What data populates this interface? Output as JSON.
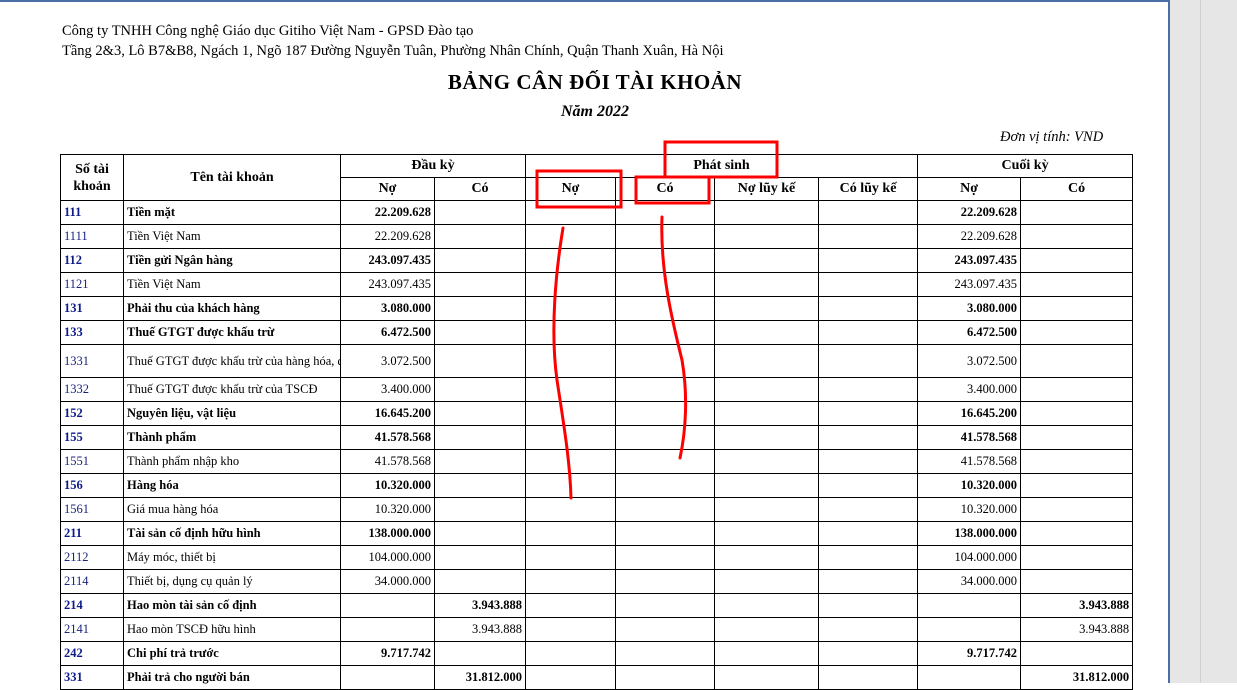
{
  "header": {
    "company": "Công ty TNHH Công nghệ Giáo dục Gitiho Việt Nam - GPSD Đào tạo",
    "address": "Tầng 2&3, Lô B7&B8, Ngách 1, Ngõ 187 Đường Nguyễn Tuân, Phường Nhân Chính, Quận Thanh Xuân, Hà Nội",
    "title": "BẢNG CÂN ĐỐI TÀI KHOẢN",
    "year": "Năm 2022",
    "unit": "Đơn vị tính: VND"
  },
  "table": {
    "col_account_no": "Số tài khoản",
    "col_account_name": "Tên tài khoản",
    "group_opening": "Đầu kỳ",
    "group_movement": "Phát sinh",
    "group_closing": "Cuối kỳ",
    "sub_debit": "Nợ",
    "sub_credit": "Có",
    "sub_cum_debit": "Nợ lũy kế",
    "sub_cum_credit": "Có lũy kế",
    "rows": [
      {
        "code": "111",
        "name": "Tiền mặt",
        "od": "22.209.628",
        "oc": "",
        "cd": "22.209.628",
        "cc": ""
      },
      {
        "code": "1111",
        "name": "Tiền Việt Nam",
        "od": "22.209.628",
        "oc": "",
        "cd": "22.209.628",
        "cc": ""
      },
      {
        "code": "112",
        "name": "Tiền gửi Ngân hàng",
        "od": "243.097.435",
        "oc": "",
        "cd": "243.097.435",
        "cc": ""
      },
      {
        "code": "1121",
        "name": "Tiền Việt Nam",
        "od": "243.097.435",
        "oc": "",
        "cd": "243.097.435",
        "cc": ""
      },
      {
        "code": "131",
        "name": "Phải thu của khách hàng",
        "od": "3.080.000",
        "oc": "",
        "cd": "3.080.000",
        "cc": ""
      },
      {
        "code": "133",
        "name": "Thuế GTGT được khấu trừ",
        "od": "6.472.500",
        "oc": "",
        "cd": "6.472.500",
        "cc": ""
      },
      {
        "code": "1331",
        "name": "Thuế GTGT được khấu trừ của hàng hóa, dịch vụ",
        "od": "3.072.500",
        "oc": "",
        "cd": "3.072.500",
        "cc": ""
      },
      {
        "code": "1332",
        "name": "Thuế GTGT được khấu trừ của TSCĐ",
        "od": "3.400.000",
        "oc": "",
        "cd": "3.400.000",
        "cc": ""
      },
      {
        "code": "152",
        "name": "Nguyên liệu, vật liệu",
        "od": "16.645.200",
        "oc": "",
        "cd": "16.645.200",
        "cc": ""
      },
      {
        "code": "155",
        "name": "Thành phẩm",
        "od": "41.578.568",
        "oc": "",
        "cd": "41.578.568",
        "cc": ""
      },
      {
        "code": "1551",
        "name": "Thành phẩm nhập kho",
        "od": "41.578.568",
        "oc": "",
        "cd": "41.578.568",
        "cc": ""
      },
      {
        "code": "156",
        "name": "Hàng hóa",
        "od": "10.320.000",
        "oc": "",
        "cd": "10.320.000",
        "cc": ""
      },
      {
        "code": "1561",
        "name": "Giá mua hàng hóa",
        "od": "10.320.000",
        "oc": "",
        "cd": "10.320.000",
        "cc": ""
      },
      {
        "code": "211",
        "name": "Tài sản cố định hữu hình",
        "od": "138.000.000",
        "oc": "",
        "cd": "138.000.000",
        "cc": ""
      },
      {
        "code": "2112",
        "name": "Máy móc, thiết bị",
        "od": "104.000.000",
        "oc": "",
        "cd": "104.000.000",
        "cc": ""
      },
      {
        "code": "2114",
        "name": "Thiết bị, dụng cụ quản lý",
        "od": "34.000.000",
        "oc": "",
        "cd": "34.000.000",
        "cc": ""
      },
      {
        "code": "214",
        "name": "Hao mòn tài sản cố định",
        "od": "",
        "oc": "3.943.888",
        "cd": "",
        "cc": "3.943.888"
      },
      {
        "code": "2141",
        "name": "Hao mòn TSCĐ hữu hình",
        "od": "",
        "oc": "3.943.888",
        "cd": "",
        "cc": "3.943.888"
      },
      {
        "code": "242",
        "name": "Chi phí trả trước",
        "od": "9.717.742",
        "oc": "",
        "cd": "9.717.742",
        "cc": ""
      },
      {
        "code": "331",
        "name": "Phải trả cho người bán",
        "od": "",
        "oc": "31.812.000",
        "cd": "",
        "cc": "31.812.000"
      }
    ]
  },
  "colors": {
    "code": "#1a237e",
    "annotation": "#ff0000",
    "frame": "#4a6fa5"
  }
}
